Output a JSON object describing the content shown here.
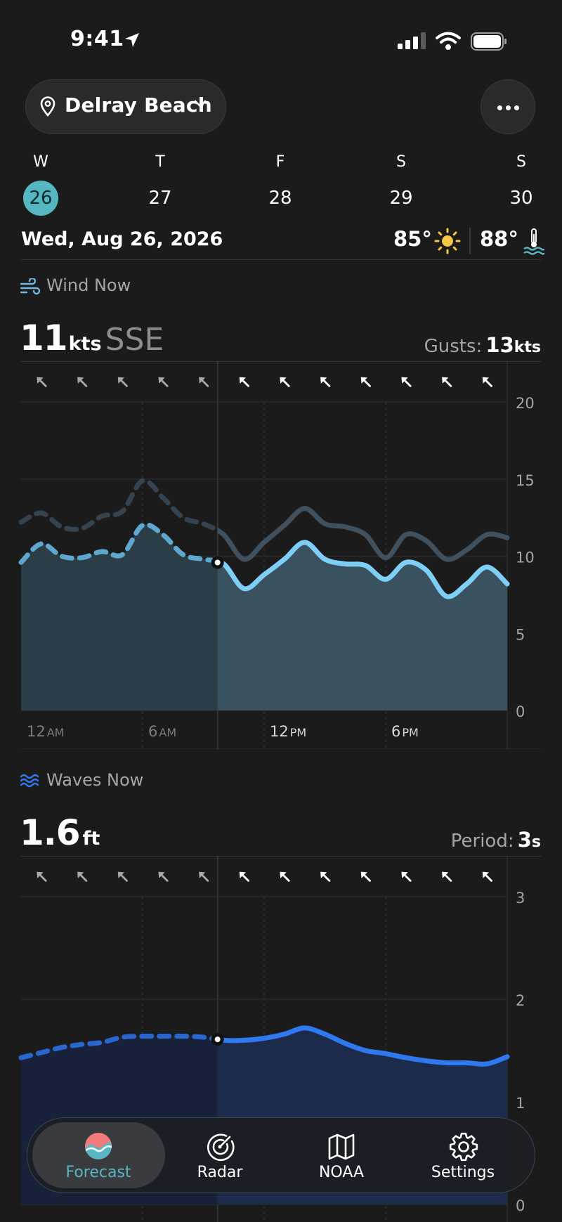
{
  "status": {
    "time": "9:41"
  },
  "location": {
    "name": "Delray Beach"
  },
  "days": [
    {
      "letter": "W",
      "num": "26",
      "selected": true
    },
    {
      "letter": "T",
      "num": "27"
    },
    {
      "letter": "F",
      "num": "28"
    },
    {
      "letter": "S",
      "num": "29"
    },
    {
      "letter": "S",
      "num": "30"
    }
  ],
  "date_line": "Wed, Aug 26, 2026",
  "air_temp": "85°",
  "water_temp": "88°",
  "wind": {
    "label": "Wind Now",
    "speed": "11",
    "unit": "kts",
    "direction": "SSE",
    "gusts_label": "Gusts:",
    "gusts_value": "13",
    "gusts_unit": "kts"
  },
  "waves": {
    "label": "Waves Now",
    "height": "1.6",
    "unit": "ft",
    "period_label": "Period:",
    "period_value": "3",
    "period_unit": "s"
  },
  "tabs": [
    {
      "label": "Forecast",
      "icon": "forecast-logo-icon",
      "active": true
    },
    {
      "label": "Radar",
      "icon": "radar-icon"
    },
    {
      "label": "NOAA",
      "icon": "map-icon"
    },
    {
      "label": "Settings",
      "icon": "gear-icon"
    }
  ],
  "colors": {
    "accent": "#56b7c2",
    "wind_line": "#7ecff6",
    "gust_line": "#3f505e",
    "wave_line": "#2f78f0",
    "background": "#1b1b1c"
  },
  "chart_data": [
    {
      "type": "area",
      "title": "Wind Now",
      "x": [
        0,
        1,
        2,
        3,
        4,
        5,
        6,
        7,
        8,
        9,
        10,
        11,
        12,
        13,
        14,
        15,
        16,
        17,
        18,
        19,
        20,
        21,
        22,
        23,
        24
      ],
      "x_ticks": [
        {
          "x": 0,
          "num": "12",
          "suffix": "AM"
        },
        {
          "x": 6,
          "num": "6",
          "suffix": "AM"
        },
        {
          "x": 12,
          "num": "12",
          "suffix": "PM"
        },
        {
          "x": 18,
          "num": "6",
          "suffix": "PM"
        }
      ],
      "y_ticks": [
        "0",
        "5",
        "10",
        "15",
        "20"
      ],
      "ylim": [
        0,
        20
      ],
      "now_x": 9.7,
      "series": [
        {
          "role": "wind",
          "values": [
            9.6,
            10.8,
            10.0,
            9.9,
            10.3,
            10.1,
            12.0,
            11.4,
            10.1,
            9.8,
            9.5,
            7.9,
            8.8,
            9.8,
            10.9,
            9.8,
            9.5,
            9.4,
            8.5,
            9.6,
            9.1,
            7.4,
            8.2,
            9.3,
            8.2
          ]
        },
        {
          "role": "gusts",
          "values": [
            12.2,
            12.8,
            11.9,
            11.8,
            12.6,
            12.9,
            14.9,
            13.8,
            12.5,
            12.1,
            11.4,
            9.8,
            10.9,
            12.0,
            13.1,
            12.1,
            11.9,
            11.4,
            9.9,
            11.4,
            11.0,
            9.8,
            10.4,
            11.4,
            11.2
          ]
        }
      ],
      "direction_arrows": 12
    },
    {
      "type": "area",
      "title": "Waves Now",
      "x": [
        0,
        1,
        2,
        3,
        4,
        5,
        6,
        7,
        8,
        9,
        10,
        11,
        12,
        13,
        14,
        15,
        16,
        17,
        18,
        19,
        20,
        21,
        22,
        23,
        24
      ],
      "y_ticks": [
        "0",
        "1",
        "2",
        "3"
      ],
      "ylim": [
        0,
        3
      ],
      "now_x": 9.7,
      "series": [
        {
          "role": "waves",
          "values": [
            1.43,
            1.48,
            1.53,
            1.56,
            1.58,
            1.63,
            1.64,
            1.64,
            1.64,
            1.63,
            1.6,
            1.6,
            1.62,
            1.66,
            1.72,
            1.66,
            1.57,
            1.5,
            1.47,
            1.43,
            1.4,
            1.38,
            1.38,
            1.37,
            1.44
          ]
        }
      ],
      "direction_arrows": 12
    }
  ]
}
